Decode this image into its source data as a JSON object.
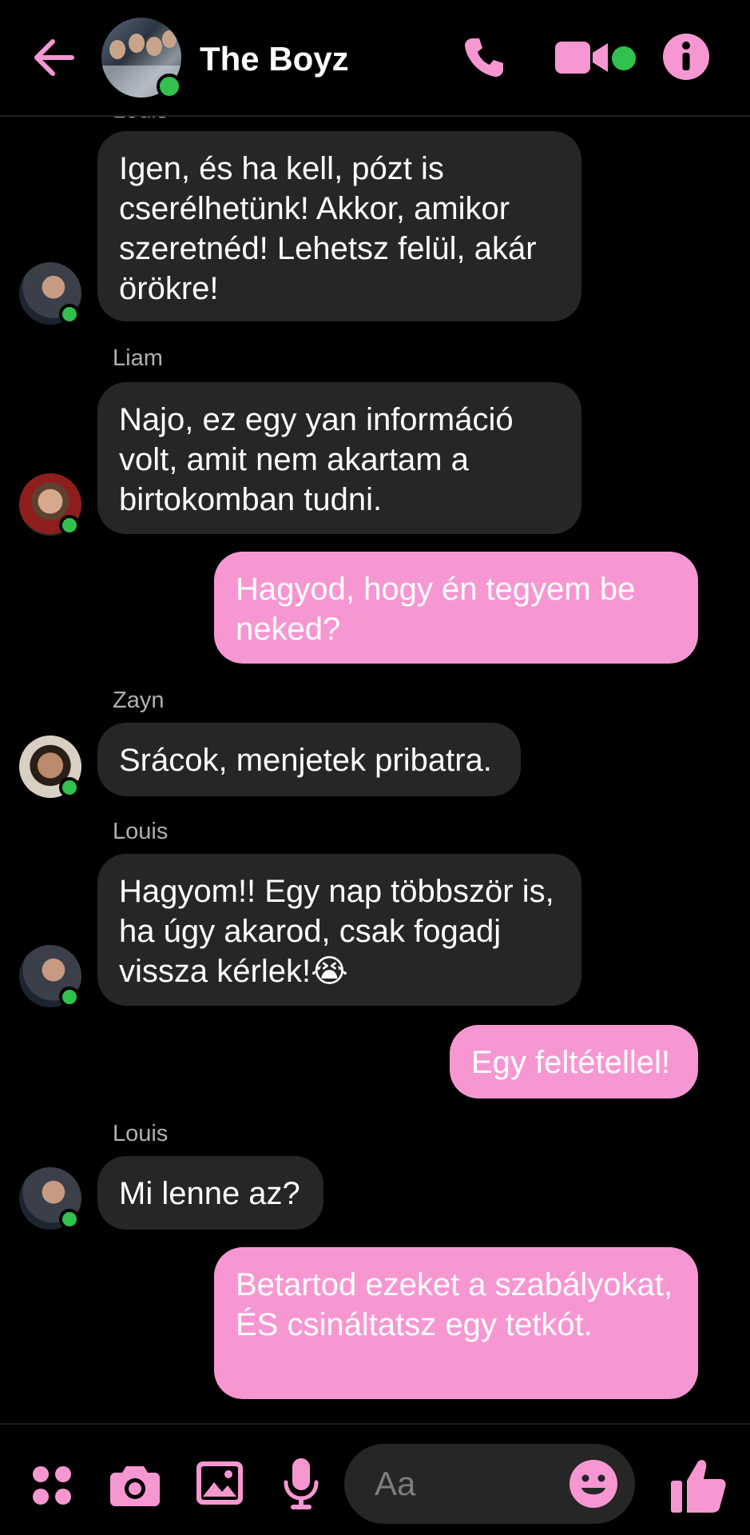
{
  "header": {
    "title": "The Boyz",
    "accent_color": "#f797d2",
    "online_color": "#31c24d"
  },
  "chat": {
    "cut_off_sender": "Louis",
    "messages": [
      {
        "sender": "",
        "mine": false,
        "avatar": "louis",
        "text": "Igen, és ha kell, pózt is cserélhetünk! Akkor, amikor szeretnéd! Lehetsz felül, akár örökre!"
      },
      {
        "sender": "Liam",
        "mine": false,
        "avatar": "liam",
        "text": "Najo, ez egy yan információ volt, amit nem akartam a birtokomban tudni."
      },
      {
        "sender": "",
        "mine": true,
        "text": "Hagyod, hogy én tegyem be neked?"
      },
      {
        "sender": "Zayn",
        "mine": false,
        "avatar": "zayn",
        "text": "Srácok, menjetek pribatra."
      },
      {
        "sender": "Louis",
        "mine": false,
        "avatar": "louis",
        "text": "Hagyom!! Egy nap többször is, ha úgy akarod, csak fogadj vissza kérlek!😭"
      },
      {
        "sender": "",
        "mine": true,
        "text": "Egy feltétellel!"
      },
      {
        "sender": "Louis",
        "mine": false,
        "avatar": "louis",
        "text": "Mi lenne az?"
      },
      {
        "sender": "",
        "mine": true,
        "text": "Betartod ezeket a szabályokat, ÉS csináltatsz egy tetkót."
      }
    ]
  },
  "composer": {
    "placeholder": "Aa",
    "icons": [
      "apps-icon",
      "camera-icon",
      "gallery-icon",
      "mic-icon",
      "emoji-icon",
      "like-icon"
    ]
  }
}
